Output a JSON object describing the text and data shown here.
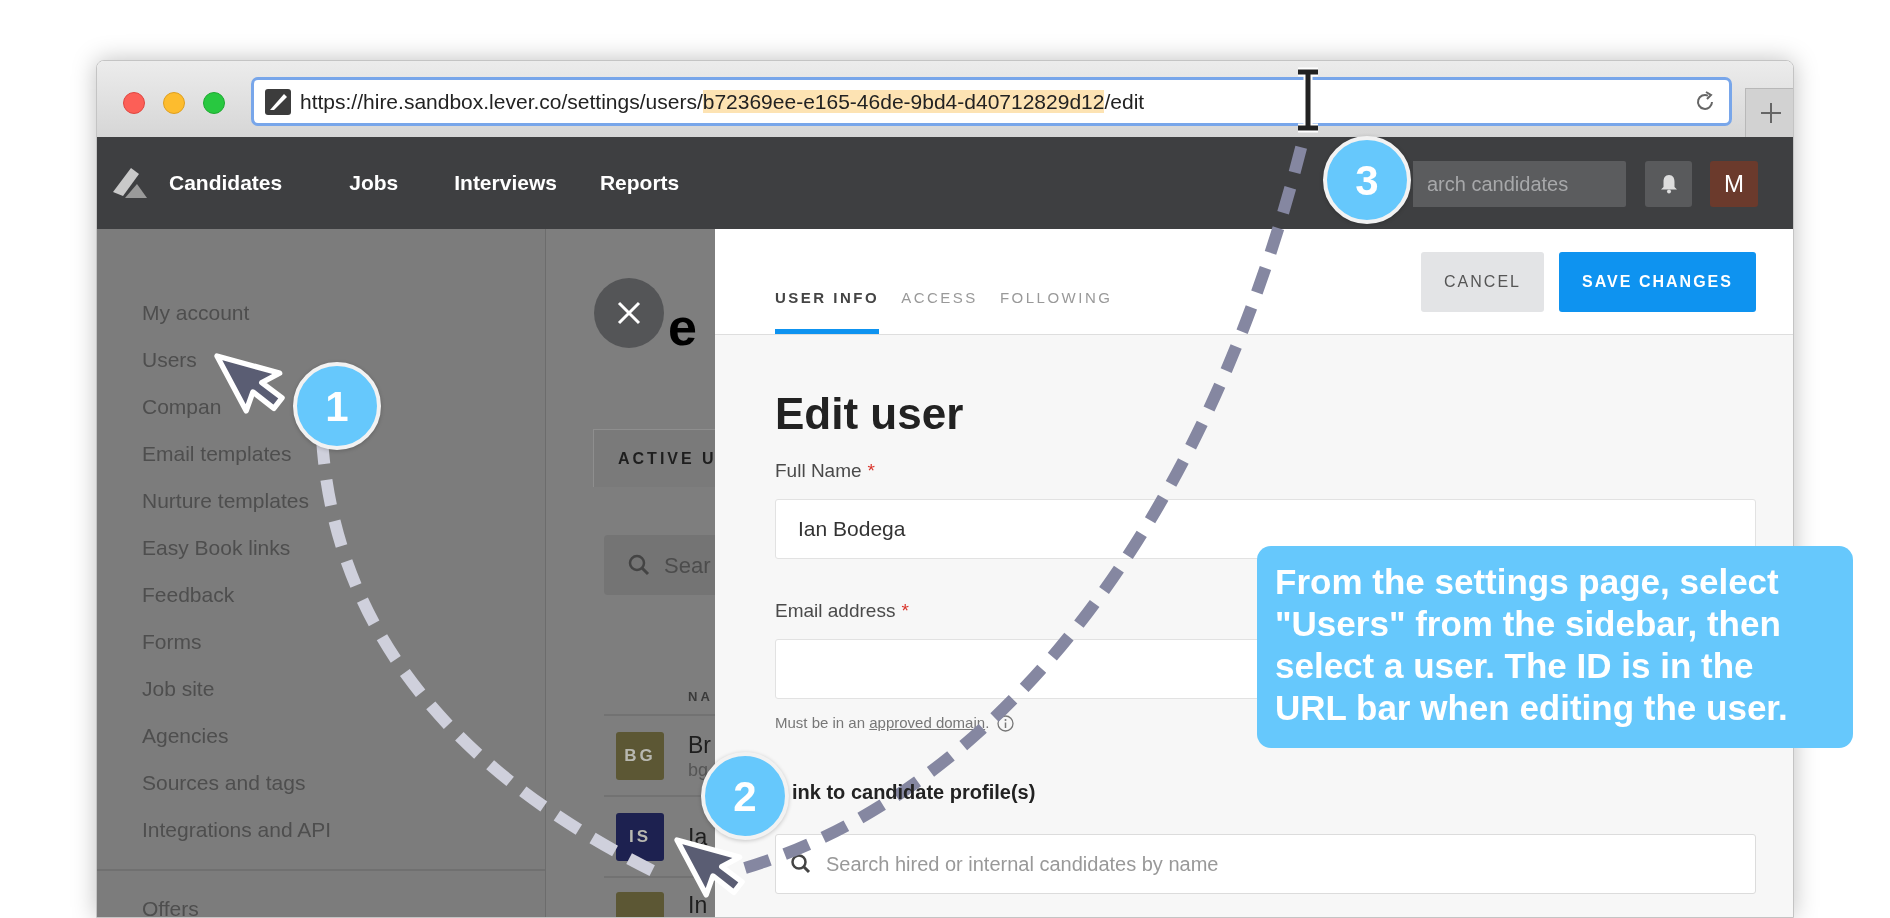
{
  "browser": {
    "url_prefix": "https://hire.sandbox.lever.co/settings/users/",
    "url_selected": "b72369ee-e165-46de-9bd4-d40712829d12",
    "url_suffix": "/edit"
  },
  "nav": {
    "items": [
      "Candidates",
      "Jobs",
      "Interviews",
      "Reports"
    ],
    "search_placeholder": "arch candidates",
    "avatar": "M"
  },
  "sidebar": {
    "items": [
      "My account",
      "Users",
      "Compan",
      "Email templates",
      "Nurture templates",
      "Easy Book links",
      "Feedback",
      "Forms",
      "Job site",
      "Agencies",
      "Sources and tags",
      "Integrations and API"
    ],
    "footer_items": [
      "Offers"
    ]
  },
  "users_page": {
    "heading": "e",
    "tab": "ACTIVE U",
    "search_placeholder": "Sear",
    "column_1": "NA",
    "rows": [
      {
        "initials": "BG",
        "color": "#5c5734",
        "name": "Br",
        "sub": "bg"
      },
      {
        "initials": "IS",
        "color": "#1d2150",
        "name": "Ia"
      },
      {
        "color": "#5c5734",
        "name": "In"
      }
    ]
  },
  "drawer": {
    "tabs": [
      {
        "label": "USER INFO",
        "selected": true
      },
      {
        "label": "ACCESS",
        "selected": false
      },
      {
        "label": "FOLLOWING",
        "selected": false
      }
    ],
    "cancel": "CANCEL",
    "save": "SAVE CHANGES",
    "title": "Edit user",
    "fields": [
      {
        "label": "Full Name",
        "required_mark": "*",
        "value": "Ian Bodega"
      },
      {
        "label": "Email address",
        "required_mark": "*",
        "hint_before": "Must be in an ",
        "hint_link": "approved domain",
        "hint_after": "."
      }
    ],
    "link_label": "ink to candidate profile(s)",
    "link_placeholder": "Search hired or internal candidates by name"
  },
  "annotations": {
    "steps": [
      "1",
      "2",
      "3"
    ],
    "callout": "From the settings page, select \"Users\" from the sidebar, then select a user. The ID is in the URL bar when editing the user."
  }
}
